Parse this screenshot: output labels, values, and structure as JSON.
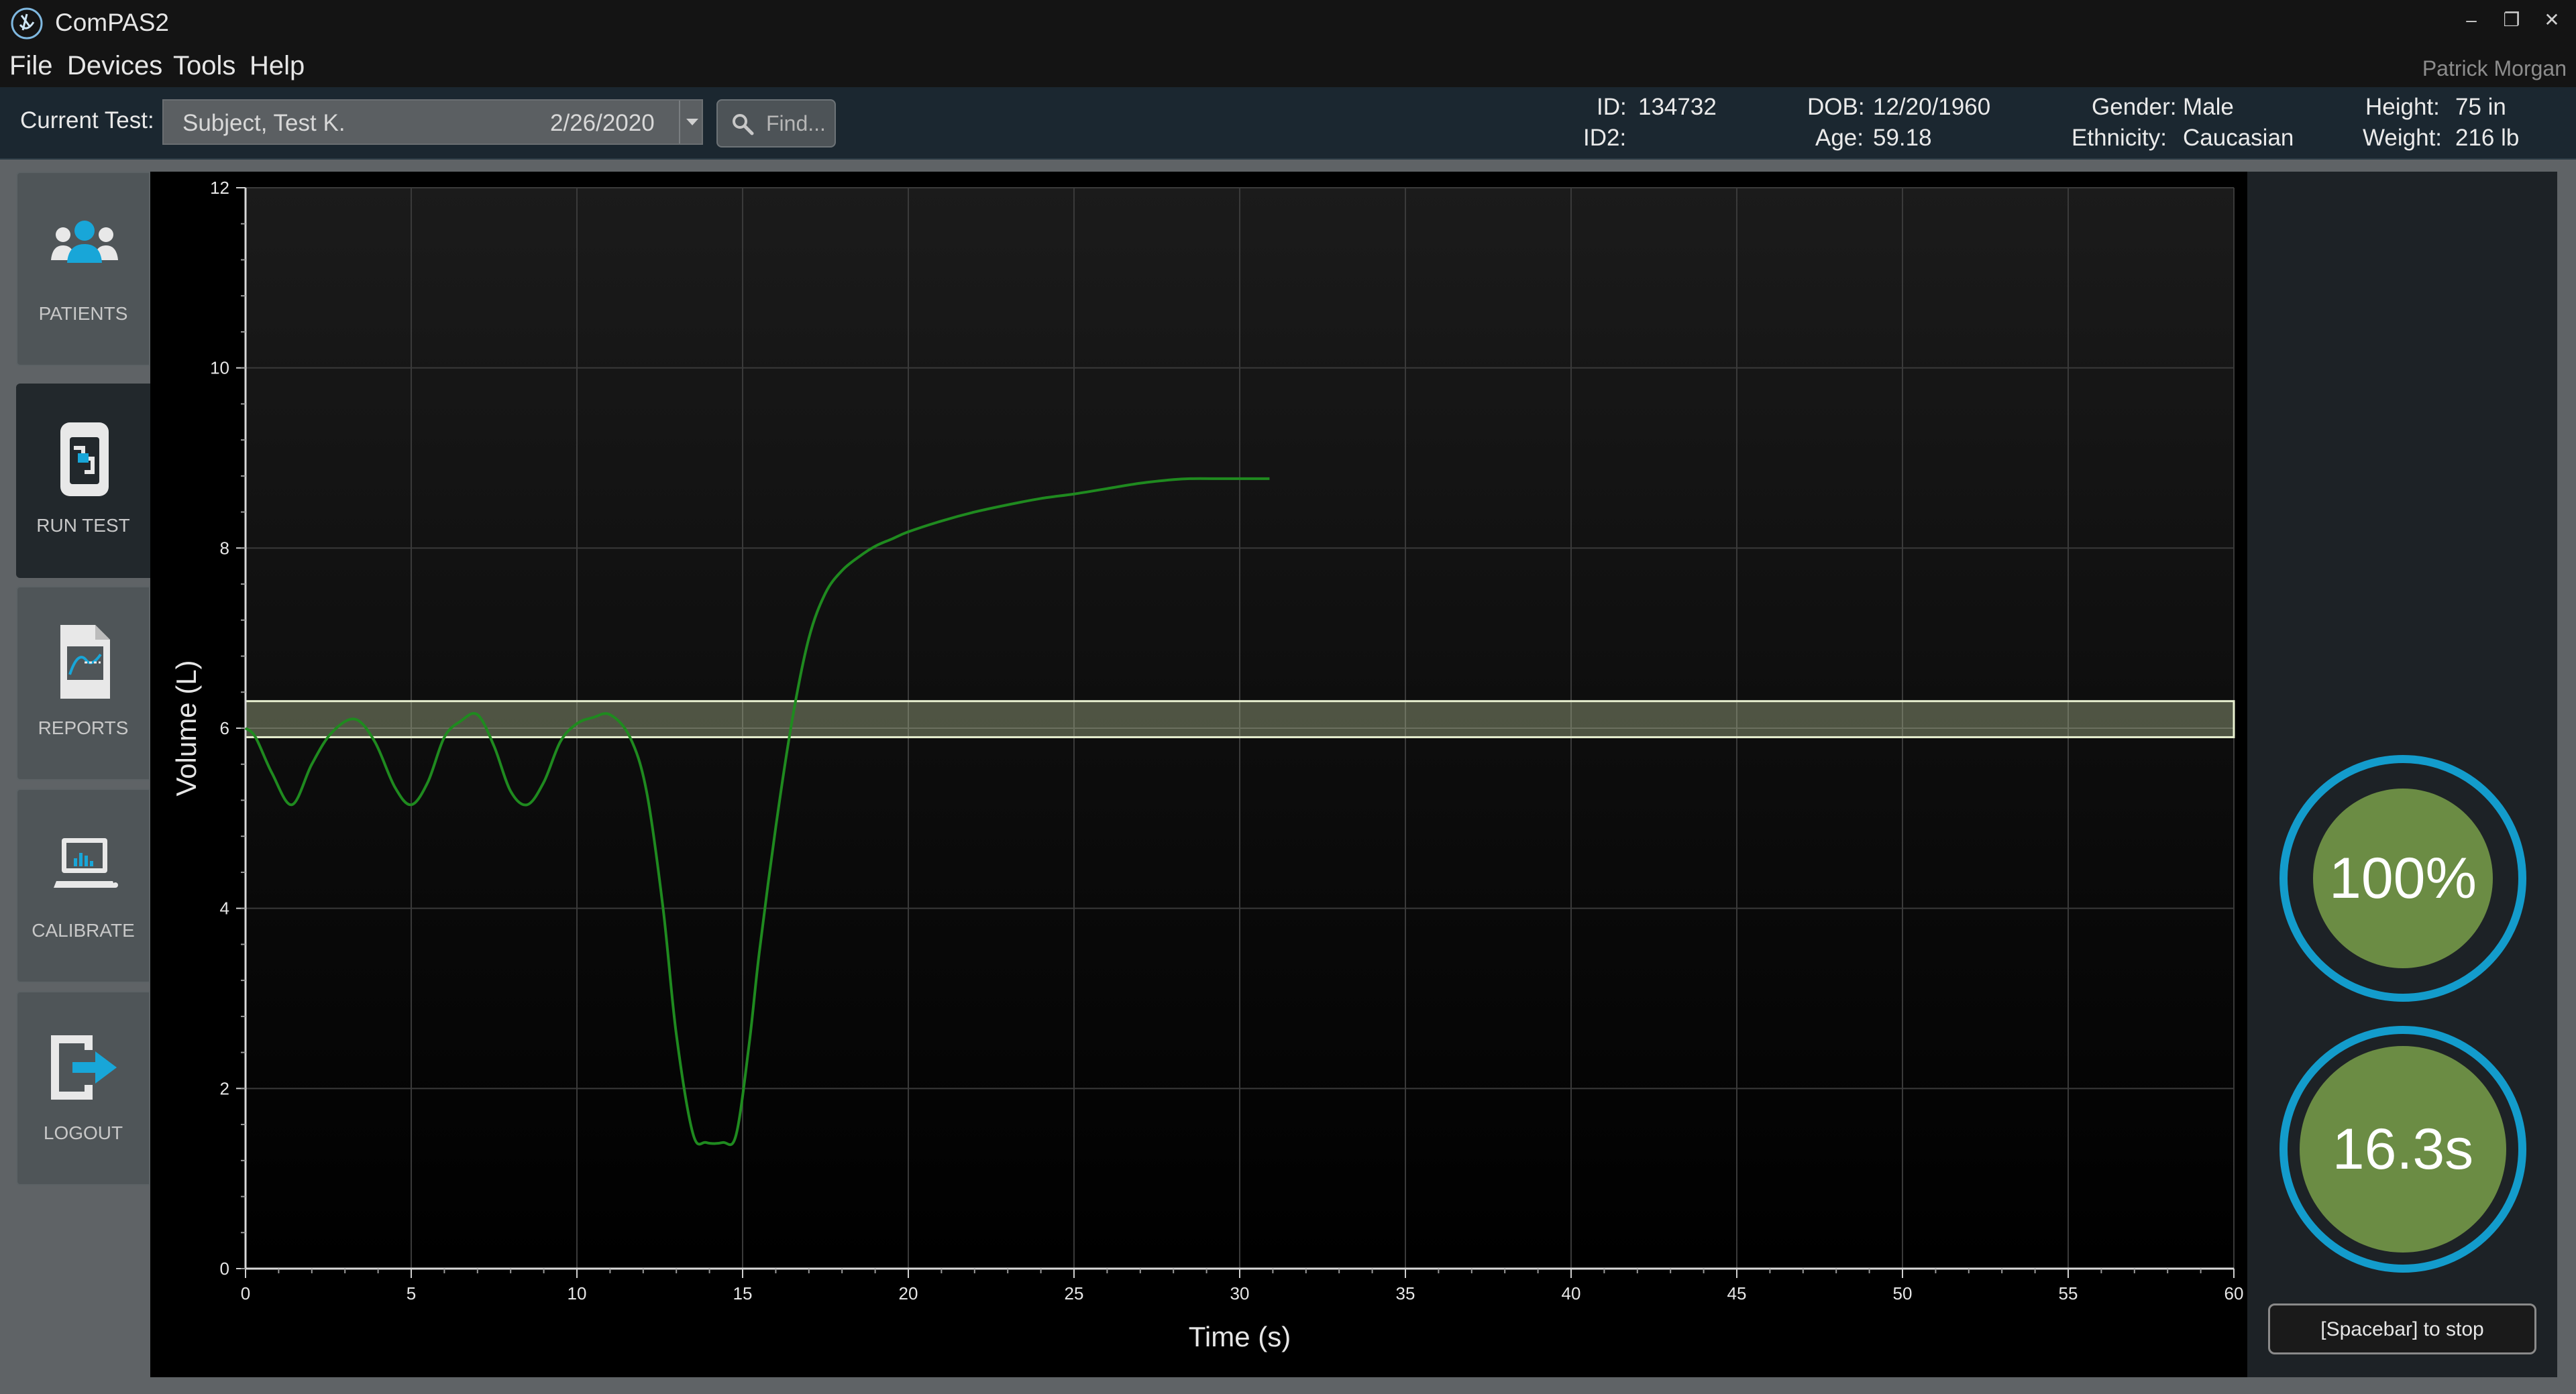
{
  "window": {
    "title": "ComPAS2",
    "minimize": "–",
    "restore": "❐",
    "close": "✕"
  },
  "menu": {
    "items": [
      "File",
      "Devices",
      "Tools",
      "Help"
    ],
    "user": "Patrick Morgan"
  },
  "current_test": {
    "label": "Current Test:",
    "subject": "Subject, Test K.",
    "date": "2/26/2020",
    "find_placeholder": "Find..."
  },
  "patient": {
    "id_label": "ID:",
    "id": "134732",
    "id2_label": "ID2:",
    "id2": "",
    "dob_label": "DOB:",
    "dob": "12/20/1960",
    "age_label": "Age:",
    "age": "59.18",
    "gender_label": "Gender:",
    "gender": "Male",
    "ethnicity_label": "Ethnicity:",
    "ethnicity": "Caucasian",
    "height_label": "Height:",
    "height": "75 in",
    "weight_label": "Weight:",
    "weight": "216 lb"
  },
  "sidebar": {
    "items": [
      {
        "label": "PATIENTS",
        "icon": "patients-icon"
      },
      {
        "label": "RUN TEST",
        "icon": "run-test-icon",
        "active": true
      },
      {
        "label": "REPORTS",
        "icon": "reports-icon"
      },
      {
        "label": "CALIBRATE",
        "icon": "calibrate-icon"
      },
      {
        "label": "LOGOUT",
        "icon": "logout-icon"
      }
    ]
  },
  "gauges": {
    "percent": "100%",
    "time": "16.3s"
  },
  "stop_button": "[Spacebar] to stop",
  "colors": {
    "accent": "#139ccc",
    "gauge_fill": "#6b8c44",
    "trace": "#1f8a1f",
    "target_band": "#c8d6a6"
  },
  "chart_data": {
    "type": "line",
    "xlabel": "Time (s)",
    "ylabel": "Volume (L)",
    "xlim": [
      0,
      60
    ],
    "ylim": [
      0,
      12
    ],
    "xticks": [
      0,
      5,
      10,
      15,
      20,
      25,
      30,
      35,
      40,
      45,
      50,
      55,
      60
    ],
    "yticks": [
      0,
      2,
      4,
      6,
      8,
      10,
      12
    ],
    "grid": true,
    "target_band": [
      5.9,
      6.3
    ],
    "series": [
      {
        "x": [
          0,
          0.3,
          0.8,
          1.4,
          2.0,
          2.6,
          3.3,
          3.9,
          4.5,
          5.0,
          5.5,
          6.0,
          6.5,
          7.0,
          7.5,
          8.0,
          8.5,
          9.0,
          9.5,
          10.0,
          10.5,
          11.0,
          11.6,
          12.1,
          12.6,
          13.0,
          13.5,
          13.9,
          14.4,
          14.8,
          15.2,
          15.5,
          16.0,
          16.5,
          17.0,
          17.5,
          18.0,
          18.5,
          19.0,
          19.5,
          20.0,
          21.0,
          22.0,
          23.0,
          24.0,
          25.0,
          26.0,
          27.0,
          28.0,
          28.5,
          29.5,
          30.5,
          30.9
        ],
        "y": [
          6.0,
          5.9,
          5.5,
          5.15,
          5.6,
          5.95,
          6.1,
          5.85,
          5.35,
          5.15,
          5.4,
          5.9,
          6.08,
          6.15,
          5.8,
          5.3,
          5.15,
          5.4,
          5.85,
          6.05,
          6.12,
          6.15,
          5.9,
          5.3,
          4.0,
          2.6,
          1.5,
          1.4,
          1.4,
          1.48,
          2.5,
          3.5,
          4.9,
          6.1,
          7.0,
          7.5,
          7.75,
          7.9,
          8.02,
          8.1,
          8.18,
          8.3,
          8.4,
          8.48,
          8.55,
          8.6,
          8.66,
          8.72,
          8.76,
          8.77,
          8.77,
          8.77,
          8.77
        ]
      }
    ]
  }
}
